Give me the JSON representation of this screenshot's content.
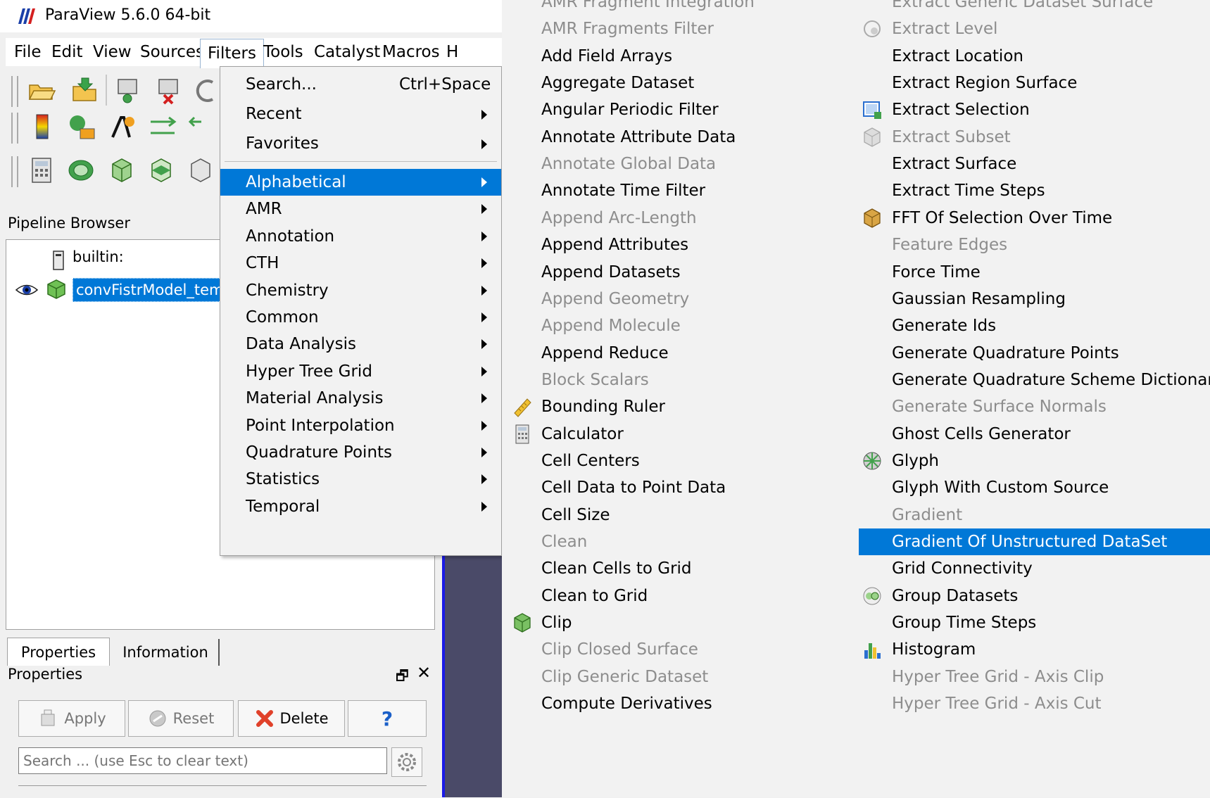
{
  "window": {
    "title": "ParaView 5.6.0 64-bit"
  },
  "menubar": {
    "items": [
      "File",
      "Edit",
      "View",
      "Sources",
      "Filters",
      "Tools",
      "Catalyst",
      "Macros",
      "H"
    ]
  },
  "pipeline": {
    "header": "Pipeline Browser",
    "items": [
      {
        "label": "builtin:"
      },
      {
        "label": "convFistrModel_temp"
      }
    ]
  },
  "panel": {
    "tabs": [
      "Properties",
      "Information"
    ],
    "title": "Properties",
    "buttons": {
      "apply": "Apply",
      "reset": "Reset",
      "delete": "Delete",
      "help": "?"
    },
    "search_placeholder": "Search ... (use Esc to clear text)"
  },
  "filters_menu": {
    "top_items": [
      {
        "label": "Search...",
        "shortcut": "Ctrl+Space"
      },
      {
        "label": "Recent"
      },
      {
        "label": "Favorites"
      }
    ],
    "categories": [
      {
        "label": "Alphabetical",
        "selected": true
      },
      {
        "label": "AMR"
      },
      {
        "label": "Annotation"
      },
      {
        "label": "CTH"
      },
      {
        "label": "Chemistry"
      },
      {
        "label": "Common"
      },
      {
        "label": "Data Analysis"
      },
      {
        "label": "Hyper Tree Grid"
      },
      {
        "label": "Material Analysis"
      },
      {
        "label": "Point Interpolation"
      },
      {
        "label": "Quadrature Points"
      },
      {
        "label": "Statistics"
      },
      {
        "label": "Temporal"
      }
    ]
  },
  "alphabetical_menu": {
    "column1": [
      {
        "label": "AMR Fragment Integration",
        "enabled": false
      },
      {
        "label": "AMR Fragments Filter",
        "enabled": false
      },
      {
        "label": "Add Field Arrays",
        "enabled": true
      },
      {
        "label": "Aggregate Dataset",
        "enabled": true
      },
      {
        "label": "Angular Periodic Filter",
        "enabled": true
      },
      {
        "label": "Annotate Attribute Data",
        "enabled": true
      },
      {
        "label": "Annotate Global Data",
        "enabled": false
      },
      {
        "label": "Annotate Time Filter",
        "enabled": true
      },
      {
        "label": "Append Arc-Length",
        "enabled": false
      },
      {
        "label": "Append Attributes",
        "enabled": true
      },
      {
        "label": "Append Datasets",
        "enabled": true
      },
      {
        "label": "Append Geometry",
        "enabled": false
      },
      {
        "label": "Append Molecule",
        "enabled": false
      },
      {
        "label": "Append Reduce",
        "enabled": true
      },
      {
        "label": "Block Scalars",
        "enabled": false
      },
      {
        "label": "Bounding Ruler",
        "enabled": true,
        "icon": "ruler-icon"
      },
      {
        "label": "Calculator",
        "enabled": true,
        "icon": "calculator-icon"
      },
      {
        "label": "Cell Centers",
        "enabled": true
      },
      {
        "label": "Cell Data to Point Data",
        "enabled": true
      },
      {
        "label": "Cell Size",
        "enabled": true
      },
      {
        "label": "Clean",
        "enabled": false
      },
      {
        "label": "Clean Cells to Grid",
        "enabled": true
      },
      {
        "label": "Clean to Grid",
        "enabled": true
      },
      {
        "label": "Clip",
        "enabled": true,
        "icon": "clip-icon"
      },
      {
        "label": "Clip Closed Surface",
        "enabled": false
      },
      {
        "label": "Clip Generic Dataset",
        "enabled": false
      },
      {
        "label": "Compute Derivatives",
        "enabled": true
      }
    ],
    "column2": [
      {
        "label": "Extract Generic Dataset Surface",
        "enabled": false
      },
      {
        "label": "Extract Level",
        "enabled": false,
        "icon": "extract-level-icon"
      },
      {
        "label": "Extract Location",
        "enabled": true
      },
      {
        "label": "Extract Region Surface",
        "enabled": true
      },
      {
        "label": "Extract Selection",
        "enabled": true,
        "icon": "extract-selection-icon"
      },
      {
        "label": "Extract Subset",
        "enabled": false,
        "icon": "extract-subset-icon"
      },
      {
        "label": "Extract Surface",
        "enabled": true
      },
      {
        "label": "Extract Time Steps",
        "enabled": true
      },
      {
        "label": "FFT Of Selection Over Time",
        "enabled": true,
        "icon": "fft-icon"
      },
      {
        "label": "Feature Edges",
        "enabled": false
      },
      {
        "label": "Force Time",
        "enabled": true
      },
      {
        "label": "Gaussian Resampling",
        "enabled": true
      },
      {
        "label": "Generate Ids",
        "enabled": true
      },
      {
        "label": "Generate Quadrature Points",
        "enabled": true
      },
      {
        "label": "Generate Quadrature Scheme Dictionary",
        "enabled": true
      },
      {
        "label": "Generate Surface Normals",
        "enabled": false
      },
      {
        "label": "Ghost Cells Generator",
        "enabled": true
      },
      {
        "label": "Glyph",
        "enabled": true,
        "icon": "glyph-icon"
      },
      {
        "label": "Glyph With Custom Source",
        "enabled": true
      },
      {
        "label": "Gradient",
        "enabled": false
      },
      {
        "label": "Gradient Of Unstructured DataSet",
        "enabled": true,
        "selected": true
      },
      {
        "label": "Grid Connectivity",
        "enabled": true
      },
      {
        "label": "Group Datasets",
        "enabled": true,
        "icon": "group-datasets-icon"
      },
      {
        "label": "Group Time Steps",
        "enabled": true
      },
      {
        "label": "Histogram",
        "enabled": true,
        "icon": "histogram-icon"
      },
      {
        "label": "Hyper Tree Grid - Axis Clip",
        "enabled": false
      },
      {
        "label": "Hyper Tree Grid - Axis Cut",
        "enabled": false
      }
    ]
  },
  "colors": {
    "selection": "#0078d7",
    "disabled_text": "#8d8d8d",
    "menu_bg": "#f2f2f2"
  }
}
